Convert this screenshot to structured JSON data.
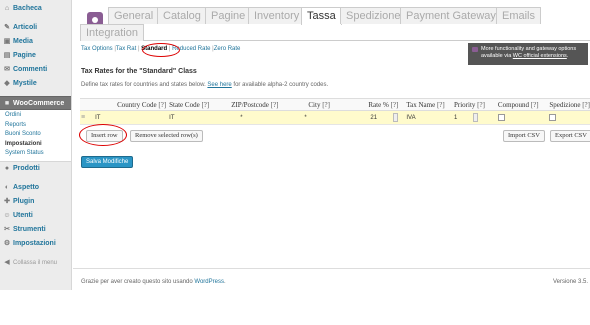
{
  "sidebar": {
    "items": [
      {
        "label": "Bacheca",
        "icon": "dashboard-icon",
        "glyph": "⌂"
      },
      {
        "label": "Articoli",
        "icon": "pin-icon",
        "glyph": "✎"
      },
      {
        "label": "Media",
        "icon": "media-icon",
        "glyph": "▣"
      },
      {
        "label": "Pagine",
        "icon": "pages-icon",
        "glyph": "▤"
      },
      {
        "label": "Commenti",
        "icon": "comment-icon",
        "glyph": "✉"
      },
      {
        "label": "Mystile",
        "icon": "theme-icon",
        "glyph": "◆"
      },
      {
        "label": "WooCommerce",
        "icon": "woocommerce-icon",
        "glyph": "■"
      },
      {
        "label": "Prodotti",
        "icon": "product-icon",
        "glyph": "●"
      },
      {
        "label": "Aspetto",
        "icon": "appearance-icon",
        "glyph": "◐"
      },
      {
        "label": "Plugin",
        "icon": "plugin-icon",
        "glyph": "✚"
      },
      {
        "label": "Utenti",
        "icon": "users-icon",
        "glyph": "☺"
      },
      {
        "label": "Strumenti",
        "icon": "tools-icon",
        "glyph": "✂"
      },
      {
        "label": "Impostazioni",
        "icon": "settings-icon",
        "glyph": "⚙"
      }
    ],
    "woo_submenu": [
      "Ordini",
      "Reports",
      "Buoni Sconto",
      "Impostazioni",
      "System Status"
    ],
    "collapse_label": "Collassa il menu",
    "collapse_glyph": "◀"
  },
  "tabs": [
    "General",
    "Catalog",
    "Pagine",
    "Inventory",
    "Tassa",
    "Spedizione",
    "Payment Gateways",
    "Emails",
    "Integration"
  ],
  "subnav": {
    "tax_options": "Tax Options",
    "tax_rates": "Tax Rat",
    "standard": "Standard",
    "reduced": "Reduced Rate",
    "zero": "Zero Rate",
    "sep": "|"
  },
  "promo": {
    "line1": "More functionality and gateway options",
    "line2_prefix": "available via ",
    "line2_link": "WC official extensions",
    "line2_suffix": "."
  },
  "section_title": "Tax Rates for the \"Standard\" Class",
  "description": {
    "prefix": "Define tax rates for countries and states below. ",
    "link": "See here",
    "suffix": " for available alpha-2 country codes."
  },
  "table": {
    "headers": [
      "Country Code",
      "State Code",
      "ZIP/Postcode",
      "City",
      "Rate %",
      "Tax Name",
      "Priority",
      "Compound",
      "Spedizione"
    ],
    "help_marker": "[?]",
    "row": {
      "handle": "≡",
      "country": "IT",
      "state": "IT",
      "zip": "*",
      "city": "*",
      "rate": "21",
      "tax_name": "IVA",
      "priority": "1"
    }
  },
  "buttons": {
    "insert_row": "Insert row",
    "remove_rows": "Remove selected row(s)",
    "import_csv": "Import CSV",
    "export_csv": "Export CSV",
    "save": "Salva Modifiche"
  },
  "footer": {
    "left_prefix": "Grazie per aver creato questo sito usando ",
    "left_link": "WordPress",
    "left_suffix": ".",
    "version": "Versione 3.5."
  },
  "colors": {
    "link": "#21759b",
    "woo_purple": "#8a5d93",
    "primary": "#2a95c5",
    "row_highlight": "#fffbcc",
    "annotation_red": "#dd0000"
  }
}
